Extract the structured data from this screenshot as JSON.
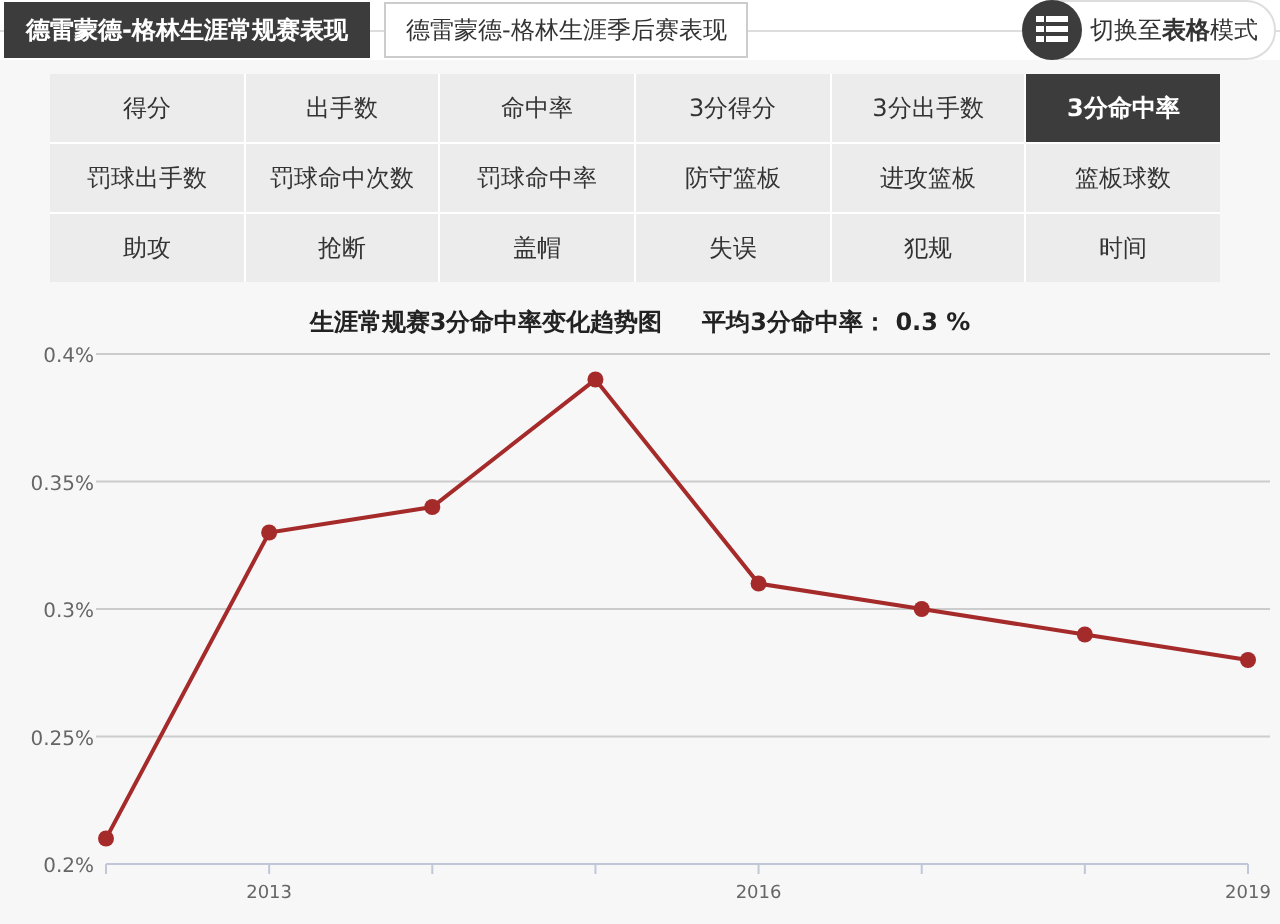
{
  "tabs": [
    {
      "label": "德雷蒙德-格林生涯常规赛表现",
      "selected": true
    },
    {
      "label": "德雷蒙德-格林生涯季后赛表现",
      "selected": false
    }
  ],
  "view_toggle": {
    "label": "切换至**表格**模式"
  },
  "stats": [
    {
      "label": "得分",
      "selected": false
    },
    {
      "label": "出手数",
      "selected": false
    },
    {
      "label": "命中率",
      "selected": false
    },
    {
      "label": "3分得分",
      "selected": false
    },
    {
      "label": "3分出手数",
      "selected": false
    },
    {
      "label": "3分命中率",
      "selected": true
    },
    {
      "label": "罚球出手数",
      "selected": false
    },
    {
      "label": "罚球命中次数",
      "selected": false
    },
    {
      "label": "罚球命中率",
      "selected": false
    },
    {
      "label": "防守篮板",
      "selected": false
    },
    {
      "label": "进攻篮板",
      "selected": false
    },
    {
      "label": "篮板球数",
      "selected": false
    },
    {
      "label": "助攻",
      "selected": false
    },
    {
      "label": "抢断",
      "selected": false
    },
    {
      "label": "盖帽",
      "selected": false
    },
    {
      "label": "失误",
      "selected": false
    },
    {
      "label": "犯规",
      "selected": false
    },
    {
      "label": "时间",
      "selected": false
    }
  ],
  "chart": {
    "average": "平均3分命中率： 0.3 %",
    "chart_data": {
      "type": "line",
      "title": "生涯常规赛3分命中率变化趋势图",
      "x": [
        2012,
        2013,
        2014,
        2015,
        2016,
        2017,
        2018,
        2019
      ],
      "series": [
        {
          "marker": "circle",
          "color": "#a52a2a",
          "values": [
            0.21,
            0.33,
            0.34,
            0.39,
            0.31,
            0.3,
            0.29,
            0.28
          ]
        }
      ],
      "xlim": [
        2012,
        2019
      ],
      "ylim": [
        0.2,
        0.4
      ],
      "grid": true,
      "xticks": [
        2013,
        2016,
        2019
      ],
      "yticks": [
        {
          "value": 0.2,
          "label": "0.2%"
        },
        {
          "value": 0.25,
          "label": "0.25%"
        },
        {
          "value": 0.3,
          "label": "0.3%"
        },
        {
          "value": 0.35,
          "label": "0.35%"
        },
        {
          "value": 0.4,
          "label": "0.4%"
        }
      ]
    }
  }
}
